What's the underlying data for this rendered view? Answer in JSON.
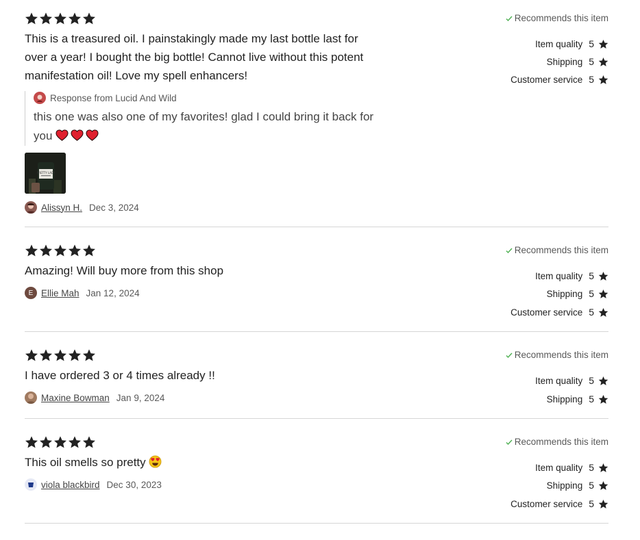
{
  "reviews": [
    {
      "rating": 5,
      "text": "This is a treasured oil. I painstakingly made my last bottle last for over a year! I bought the big bottle! Cannot live without this potent manifestation oil! Love my spell enhancers!",
      "recommends": "Recommends this item",
      "ratings": [
        {
          "label": "Item quality",
          "value": "5"
        },
        {
          "label": "Shipping",
          "value": "5"
        },
        {
          "label": "Customer service",
          "value": "5"
        }
      ],
      "response": {
        "heading": "Response from Lucid And Wild",
        "text": "this one was also one of my favorites! glad I could bring it back for you",
        "emoji": "heart-icon x3"
      },
      "photo_label": "PRETTY LADY",
      "reviewer": "Alissyn H.",
      "date": "Dec 3, 2024"
    },
    {
      "rating": 5,
      "text": "Amazing! Will buy more from this shop",
      "recommends": "Recommends this item",
      "ratings": [
        {
          "label": "Item quality",
          "value": "5"
        },
        {
          "label": "Shipping",
          "value": "5"
        },
        {
          "label": "Customer service",
          "value": "5"
        }
      ],
      "reviewer": "Ellie Mah",
      "avatar_initial": "E",
      "date": "Jan 12, 2024"
    },
    {
      "rating": 5,
      "text": "I have ordered 3 or 4 times already !!",
      "recommends": "Recommends this item",
      "ratings": [
        {
          "label": "Item quality",
          "value": "5"
        },
        {
          "label": "Shipping",
          "value": "5"
        }
      ],
      "reviewer": "Maxine Bowman",
      "date": "Jan 9, 2024"
    },
    {
      "rating": 5,
      "text": "This oil smells so pretty",
      "text_emoji": "heart-eyes-emoji-icon",
      "recommends": "Recommends this item",
      "ratings": [
        {
          "label": "Item quality",
          "value": "5"
        },
        {
          "label": "Shipping",
          "value": "5"
        },
        {
          "label": "Customer service",
          "value": "5"
        }
      ],
      "reviewer": "viola blackbird",
      "date": "Dec 30, 2023"
    }
  ],
  "colors": {
    "text": "#222222",
    "muted": "#595959",
    "check": "#4caf50",
    "divider": "#d6d6d6",
    "heart": "#e0202e"
  }
}
